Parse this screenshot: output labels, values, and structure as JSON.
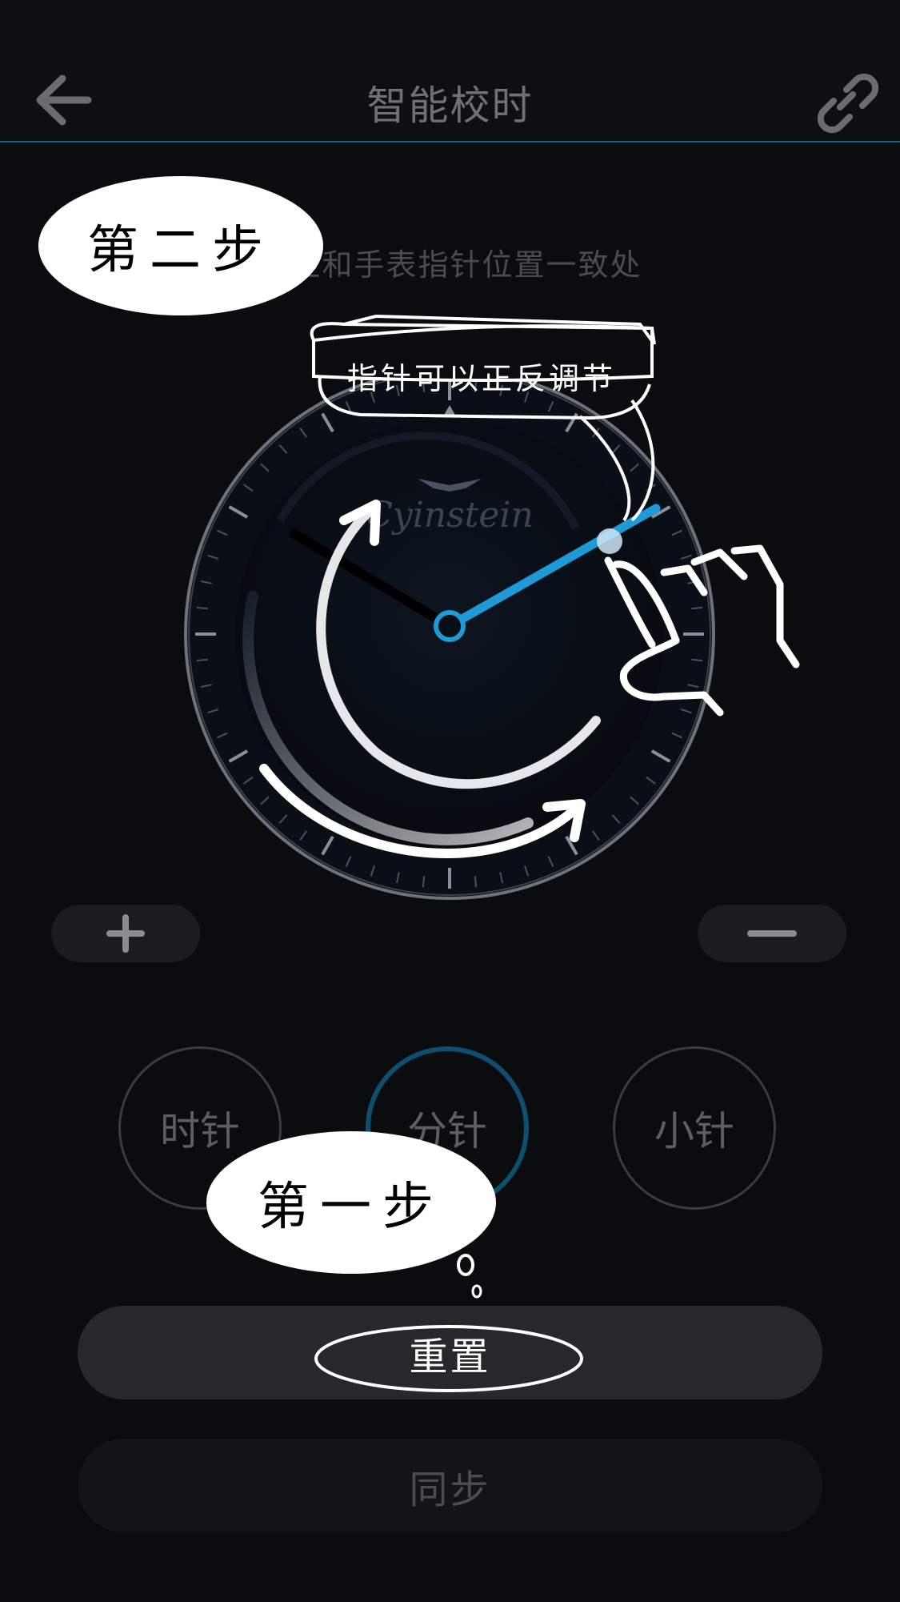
{
  "header": {
    "title": "智能校时",
    "back_icon": "back-arrow-icon",
    "link_icon": "link-icon"
  },
  "instruction": "拨至和手表指针位置一致处",
  "watch": {
    "brand": "Cyinstein",
    "logo_icon": "wing-logo-icon"
  },
  "adjust": {
    "plus_icon": "plus-icon",
    "minus_icon": "minus-icon"
  },
  "hands": [
    {
      "label": "时针",
      "active": false
    },
    {
      "label": "分针",
      "active": true
    },
    {
      "label": "小针",
      "active": false
    }
  ],
  "buttons": {
    "reset": "重置",
    "sync": "同步"
  },
  "annotations": {
    "step_two": "第二步",
    "step_one": "第一步",
    "tip": "指针可以正反调节"
  },
  "colors": {
    "accent": "#1e9ad6",
    "background": "#0b0c0e"
  }
}
